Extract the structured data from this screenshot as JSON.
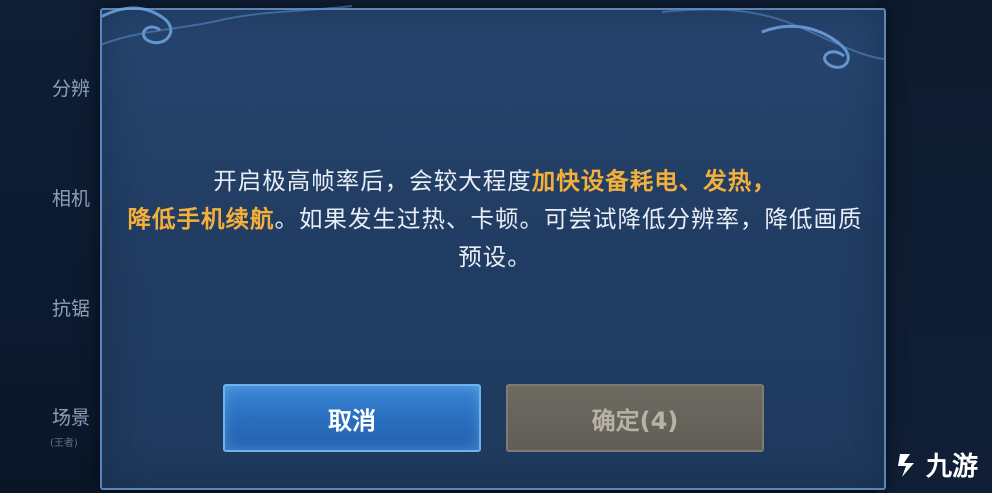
{
  "background": {
    "sidebar_labels": [
      "分辨",
      "相机",
      "抗锯",
      "场景"
    ],
    "sidebar_sublabel": "(王者)"
  },
  "dialog": {
    "message_part1": "开启极高帧率后，会较大程度",
    "message_highlight1": "加快设备耗电、发热，",
    "message_highlight2": "降低手机续航",
    "message_part2": "。如果发生过热、卡顿。可尝试降低分辨率，降低画质预设。",
    "cancel_label": "取消",
    "confirm_label": "确定(4)"
  },
  "watermark": {
    "text": "九游",
    "icon": "jiuyou-logo-icon"
  },
  "colors": {
    "highlight": "#f4b03a",
    "primary_button": "#2a6fbf",
    "disabled_button": "#605e56"
  }
}
